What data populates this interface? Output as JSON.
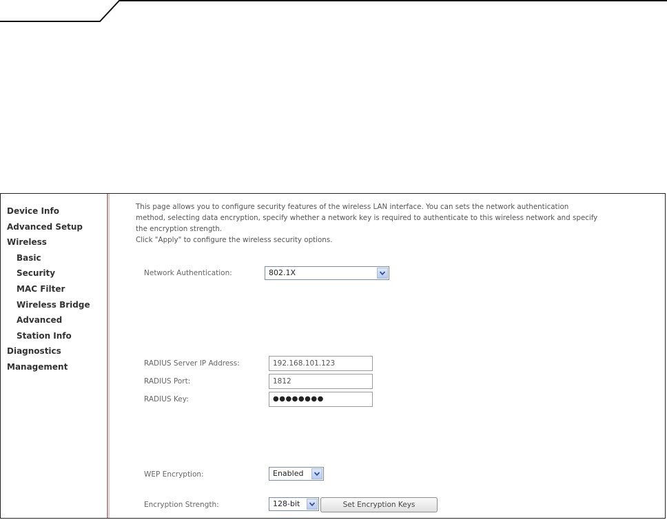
{
  "sidebar": {
    "items": [
      {
        "label": "Device Info",
        "level": "top"
      },
      {
        "label": "Advanced Setup",
        "level": "top"
      },
      {
        "label": "Wireless",
        "level": "top"
      },
      {
        "label": "Basic",
        "level": "sub"
      },
      {
        "label": "Security",
        "level": "sub"
      },
      {
        "label": "MAC Filter",
        "level": "sub"
      },
      {
        "label": "Wireless Bridge",
        "level": "sub"
      },
      {
        "label": "Advanced",
        "level": "sub"
      },
      {
        "label": "Station Info",
        "level": "sub"
      },
      {
        "label": "Diagnostics",
        "level": "top"
      },
      {
        "label": "Management",
        "level": "top"
      }
    ]
  },
  "intro": {
    "line1": "This page allows you to configure security features of the wireless LAN interface. You can sets the network authentication",
    "line2": "method, selecting data encryption, specify whether a network key is required to authenticate to this wireless network and specify",
    "line3": "the encryption strength.",
    "line4": "Click \"Apply\" to configure the wireless security options."
  },
  "form": {
    "auth_label": "Network Authentication:",
    "auth_value": "802.1X",
    "radius_ip_label": "RADIUS Server IP Address:",
    "radius_ip_value": "192.168.101.123",
    "radius_port_label": "RADIUS Port:",
    "radius_port_value": "1812",
    "radius_key_label": "RADIUS Key:",
    "radius_key_value": "●●●●●●●●",
    "wep_label": "WEP Encryption:",
    "wep_value": "Enabled",
    "strength_label": "Encryption Strength:",
    "strength_value": "128-bit",
    "set_keys_button": "Set Encryption Keys"
  },
  "icons": {
    "dropdown": "chevron-down-icon"
  },
  "colors": {
    "divider": "#c98a8a",
    "select_border": "#7a8ca8",
    "arrow_button": "#b8c9f2"
  }
}
